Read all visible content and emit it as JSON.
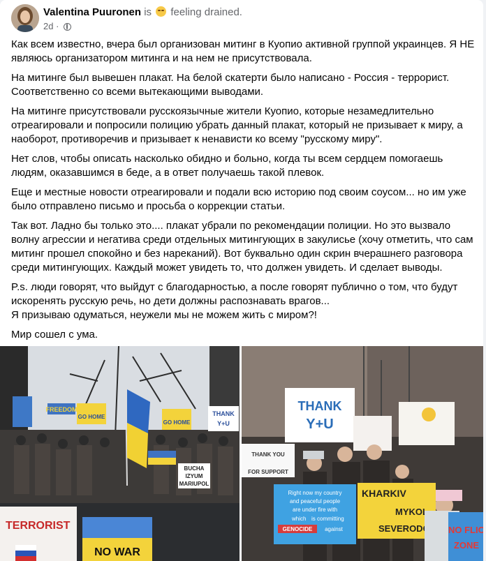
{
  "author": {
    "name": "Valentina Puuronen",
    "feeling_prefix": "is",
    "feeling_text": "feeling drained."
  },
  "post_meta": {
    "time": "2d",
    "separator": "·",
    "privacy_icon": "globe-icon"
  },
  "paragraphs": [
    "Как всем известно, вчера был организован митинг в Куопио активной группой украинцев.  Я НЕ являюсь организатором митинга и на нем не присутствовала.",
    "На митинге  был вывешен плакат. На белой скатерти было написано - Россия - террорист. Соответственно  со всеми вытекающими  выводами.",
    "На митинге присутствовали русскоязычные жители Куопио, которые незамедлительно отреагировали и попросили полицию убрать данный плакат, который не призывает к миру, а наоборот, противоречив и призывает к ненависти ко всему \"русскому миру\".",
    "Нет слов, чтобы описать насколько обидно и больно, когда ты всем сердцем помогаешь людям, оказавшимся в беде, а в ответ получаешь такой плевок.",
    "Еще и местные новости отреагировали и подали всю историю под своим соусом... но им уже было отправлено письмо и просьба о коррекции статьи.",
    "Так вот. Ладно бы только это.... плакат убрали по рекомендации полиции. Но это вызвало волну агрессии и негатива среди отдельных митингующих в закулисье (хочу отметить, что сам митинг прошел спокойно и без нареканий). Вот буквально один скрин вчерашнего разговора среди митингующих. Каждый может увидеть то, что должен увидеть. И сделает выводы.",
    "P.s. люди говорят, что выйдут с благодарностью, а после говорят публично о том, что будут искоренять русскую речь, но дети должны распознавать врагов...\nЯ призываю одуматься, неужели мы не можем жить с миром?!",
    "Мир сошел с ума."
  ],
  "photo1_signs": [
    "FREEDOM",
    "GO HOME",
    "GO HOME",
    "THANK",
    "Y+U",
    "BUCHA",
    "IZYUM",
    "MARIUPOL",
    "TERRORIST",
    "NO WAR"
  ],
  "photo2_signs": [
    "THANK",
    "Y+U",
    "THANK YOU",
    "FOR SUPPORT",
    "Right now my country",
    "and peaceful people",
    "are under fire with",
    "which",
    "is committing",
    "GENOCIDE",
    "against",
    "KHARKIV",
    "MYKOL",
    "SEVERODO",
    "NO FLIC",
    "ZONE"
  ]
}
